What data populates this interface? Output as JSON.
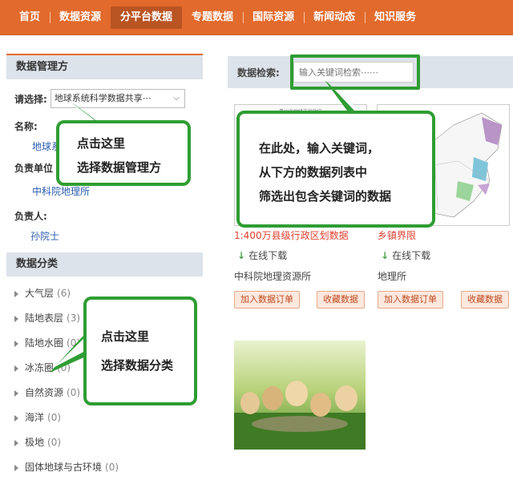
{
  "nav": {
    "items": [
      "首页",
      "数据资源",
      "分平台数据",
      "专题数据",
      "国际资源",
      "新闻动态",
      "知识服务"
    ],
    "active_index": 2
  },
  "sidebar": {
    "manager_section_title": "数据管理方",
    "select_label": "请选择:",
    "select_value": "地球系统科学数据共享⋯",
    "name_label": "名称:",
    "name_value": "地球系",
    "unit_label": "负责单位",
    "unit_value": "中科院地理所",
    "person_label": "负责人:",
    "person_value": "孙院士",
    "category_section_title": "数据分类",
    "categories": [
      {
        "name": "大气层",
        "count": "(6)"
      },
      {
        "name": "陆地表层",
        "count": "(3)"
      },
      {
        "name": "陆地水圈",
        "count": "(0)"
      },
      {
        "name": "冰冻圈",
        "count": "(0)"
      },
      {
        "name": "自然资源",
        "count": "(0)"
      },
      {
        "name": "海洋",
        "count": "(0)"
      },
      {
        "name": "极地",
        "count": "(0)"
      },
      {
        "name": "固体地球与古环境",
        "count": "(0)"
      }
    ]
  },
  "search": {
    "label": "数据检索:",
    "placeholder": "输入关键词检索⋯⋯"
  },
  "cards": [
    {
      "title": "1:400万县级行政区划数据",
      "download": "在线下载",
      "org": "中科院地理资源所",
      "order_btn": "加入数据订单",
      "fav_btn": "收藏数据",
      "thumb_caption": "贵州省地级市行政区"
    },
    {
      "title": "乡镇界限",
      "download": "在线下载",
      "org": "地理所",
      "order_btn": "加入数据订单",
      "fav_btn": "收藏数据"
    },
    {
      "title": "",
      "thumb": "puppies-photo"
    }
  ],
  "callouts": {
    "manager": [
      "点击这里",
      "选择数据管理方"
    ],
    "search": [
      "在此处，输入关键词，",
      "从下方的数据列表中",
      "筛选出包含关键词的数据"
    ],
    "category": [
      "点击这里",
      "选择数据分类"
    ]
  },
  "colors": {
    "nav_bg": "#e26a2c",
    "nav_active": "#b95423",
    "callout_border": "#2f9d33",
    "title_red": "#e2402c",
    "link_blue": "#2a5db0"
  }
}
